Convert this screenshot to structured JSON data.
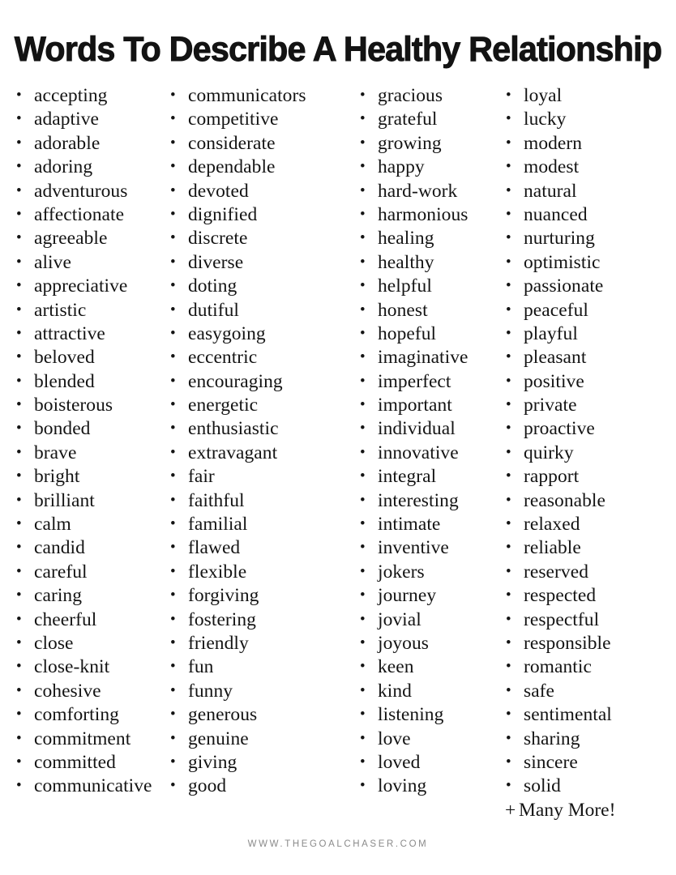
{
  "page": {
    "title": "Words To Describe A Healthy Relationship",
    "background_color": "#ffffff",
    "text_color": "#141414",
    "footer_color": "#8a8a8a",
    "bullet_glyph": "•",
    "more_glyph": "+"
  },
  "columns": [
    {
      "name": "column-1",
      "words": [
        "accepting",
        "adaptive",
        "adorable",
        "adoring",
        "adventurous",
        "affectionate",
        "agreeable",
        "alive",
        "appreciative",
        "artistic",
        "attractive",
        "beloved",
        "blended",
        "boisterous",
        "bonded",
        "brave",
        "bright",
        "brilliant",
        "calm",
        "candid",
        "careful",
        "caring",
        "cheerful",
        "close",
        "close-knit",
        "cohesive",
        "comforting",
        "commitment",
        "committed",
        "communicative"
      ]
    },
    {
      "name": "column-2",
      "words": [
        "communicators",
        "competitive",
        "considerate",
        "dependable",
        "devoted",
        "dignified",
        "discrete",
        "diverse",
        "doting",
        "dutiful",
        "easygoing",
        "eccentric",
        "encouraging",
        "energetic",
        "enthusiastic",
        "extravagant",
        "fair",
        "faithful",
        "familial",
        "flawed",
        "flexible",
        "forgiving",
        "fostering",
        "friendly",
        "fun",
        "funny",
        "generous",
        "genuine",
        "giving",
        "good"
      ]
    },
    {
      "name": "column-3",
      "words": [
        "gracious",
        "grateful",
        "growing",
        "happy",
        "hard-work",
        "harmonious",
        "healing",
        "healthy",
        "helpful",
        "honest",
        "hopeful",
        "imaginative",
        "imperfect",
        "important",
        "individual",
        "innovative",
        "integral",
        "interesting",
        "intimate",
        "inventive",
        "jokers",
        "journey",
        "jovial",
        "joyous",
        "keen",
        "kind",
        "listening",
        "love",
        "loved",
        "loving"
      ]
    },
    {
      "name": "column-4",
      "words": [
        "loyal",
        "lucky",
        "modern",
        "modest",
        "natural",
        "nuanced",
        "nurturing",
        "optimistic",
        "passionate",
        "peaceful",
        "playful",
        "pleasant",
        "positive",
        "private",
        "proactive",
        "quirky",
        "rapport",
        "reasonable",
        "relaxed",
        "reliable",
        "reserved",
        "respected",
        "respectful",
        "responsible",
        "romantic",
        "safe",
        "sentimental",
        "sharing",
        "sincere",
        "solid"
      ],
      "trailing_note": "Many More!"
    }
  ],
  "footer": {
    "watermark": "WWW.THEGOALCHASER.COM"
  }
}
